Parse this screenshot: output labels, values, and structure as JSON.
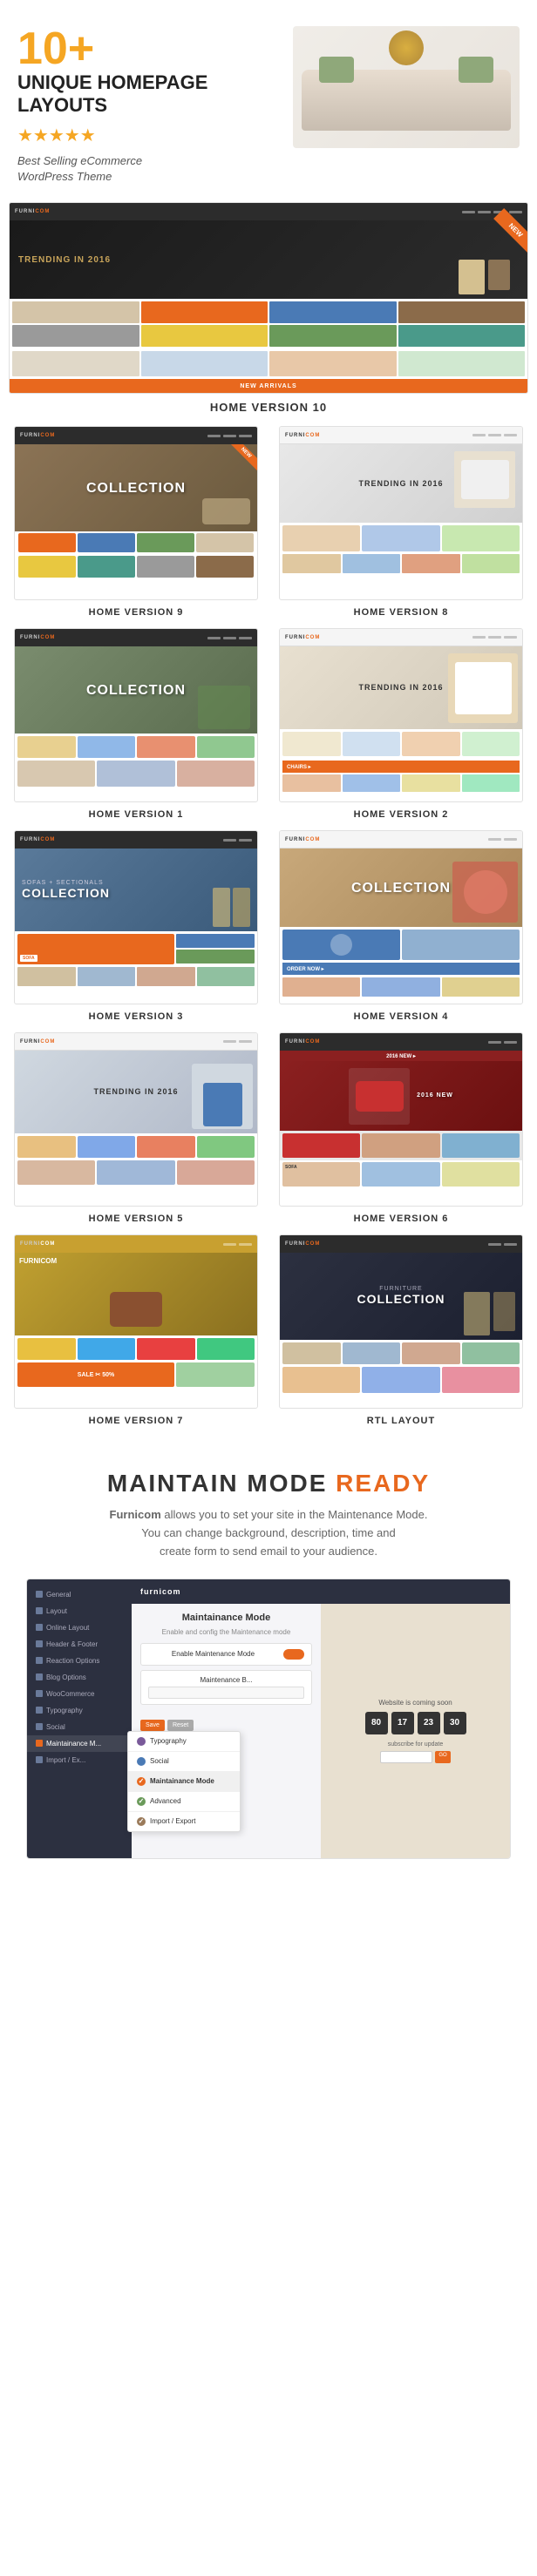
{
  "hero": {
    "number": "10+",
    "title": "UNIQUE HOMEPAGE\nLAYOUTS",
    "stars": "★★★★★",
    "subtitle": "Best Selling eCommerce\nWordPress Theme"
  },
  "home_version_10": {
    "label": "HOME VERSION 10"
  },
  "versions": [
    {
      "id": "v9",
      "label": "HOME VERSION 9",
      "badge": "NEW",
      "hero_text": "COLLECTION",
      "style": "v9"
    },
    {
      "id": "v8",
      "label": "HOME VERSION 8",
      "hero_text": "TRENDING IN 2016",
      "style": "v8"
    },
    {
      "id": "v1",
      "label": "HOME VERSION 1",
      "hero_text": "COLLECTION",
      "style": "v1"
    },
    {
      "id": "v2",
      "label": "HOME VERSION 2",
      "hero_text": "TRENDING IN 2016",
      "style": "v2"
    },
    {
      "id": "v3",
      "label": "HOME VERSION 3",
      "hero_text": "SOFAS + SECTIONALS\nCOLLECTION",
      "style": "v3"
    },
    {
      "id": "v4",
      "label": "HOME VERSION 4",
      "hero_text": "COLLECTION",
      "style": "v4"
    },
    {
      "id": "v5",
      "label": "HOME VERSION 5",
      "hero_text": "TRENDING IN 2016",
      "style": "v5"
    },
    {
      "id": "v6",
      "label": "HOME VERSION 6",
      "hero_text": "2016 NEW",
      "style": "v6"
    },
    {
      "id": "v7",
      "label": "HOME VERSION 7",
      "hero_text": "SALE 50%",
      "style": "v7"
    },
    {
      "id": "rtl",
      "label": "RTL LAYOUT",
      "hero_text": "FURNITURE\nCOLLECTION",
      "style": "rtl"
    }
  ],
  "maintain": {
    "title_part1": "MAINTAIN MODE",
    "title_part2": "READY",
    "description": "Furnicom allows you to set your site in the Maintenance Mode.\nYou can change background, description, time and\ncreate form to send email to your audience.",
    "screenshot": {
      "top_bar_logo": "furnicom",
      "main_title": "Maintainance Mode",
      "main_sub": "Enable and config the Maintenance mode",
      "toggle_label": "Enable Maintenance Mode",
      "input_label": "Maintenance B...",
      "countdown_title": "Website is coming soon",
      "subscribe_label": "subscribe for update",
      "countdown_values": [
        "80",
        "17",
        "23",
        "30"
      ],
      "countdown_labels": [
        "",
        "",
        "",
        ""
      ],
      "sidebar_items": [
        {
          "label": "General",
          "active": false
        },
        {
          "label": "Layout",
          "active": false
        },
        {
          "label": "Online Layout",
          "active": false
        },
        {
          "label": "Header & Footer",
          "active": false
        },
        {
          "label": "Reaction Options",
          "active": false
        },
        {
          "label": "Blog Options",
          "active": false
        },
        {
          "label": "WooCommerce",
          "active": false
        },
        {
          "label": "Typography",
          "active": false
        },
        {
          "label": "Social",
          "active": false
        },
        {
          "label": "Maintainance M...",
          "active": true
        },
        {
          "label": "Import / Ex...",
          "active": false
        }
      ],
      "popup_items": [
        {
          "label": "Typography",
          "active": false
        },
        {
          "label": "Social",
          "active": false
        },
        {
          "label": "Maintainance Mode",
          "active": true
        },
        {
          "label": "Advanced",
          "active": false
        },
        {
          "label": "Import / Export",
          "active": false
        }
      ]
    }
  }
}
